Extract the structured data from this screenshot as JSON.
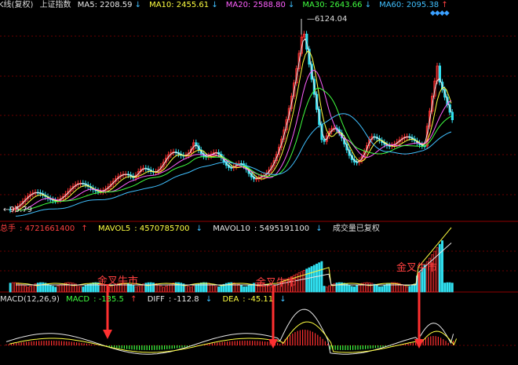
{
  "header": {
    "title": "K线(复权)",
    "index_name": "上证指数",
    "ma": [
      {
        "label": "MA5",
        "value": "2208.59",
        "arrow": "↓",
        "color": "#e8e8e8"
      },
      {
        "label": "MA10",
        "value": "2455.61",
        "arrow": "↓",
        "color": "#ffff40"
      },
      {
        "label": "MA20",
        "value": "2588.80",
        "arrow": "↓",
        "color": "#ff60ff"
      },
      {
        "label": "MA30",
        "value": "2643.66",
        "arrow": "↓",
        "color": "#40ff40"
      },
      {
        "label": "MA60",
        "value": "2095.38",
        "arrow": "↑",
        "color": "#40c0ff"
      }
    ]
  },
  "volume_header": {
    "total_label": "总手",
    "total_value": "4721661400",
    "total_arrow": "↑",
    "mavol5_label": "MAVOL5",
    "mavol5_value": "4570785700",
    "mavol5_arrow": "↓",
    "mavol10_label": "MAVOL10",
    "mavol10_value": "5495191100",
    "mavol10_arrow": "↓",
    "note": "成交量已复权"
  },
  "macd_header": {
    "name": "MACD(12,26,9)",
    "macd_label": "MACD",
    "macd_value": "-135.5",
    "macd_arrow": "↑",
    "diff_label": "DIFF",
    "diff_value": "-112.8",
    "diff_arrow": "↓",
    "dea_label": "DEA",
    "dea_value": "-45.11",
    "dea_arrow": "↓"
  },
  "annotations": {
    "peak_label": "6124.04",
    "low_label": "95.79",
    "bull_signal_1": "金叉牛市",
    "bull_signal_2": "金叉牛市",
    "bull_signal_3": "金叉牛市"
  },
  "icons": {
    "toolbar": "diamond-icon"
  },
  "colors": {
    "up": "#ff3030",
    "down": "#30e0f0",
    "grid": "#7a0000",
    "arrow": "#ff3030"
  }
}
